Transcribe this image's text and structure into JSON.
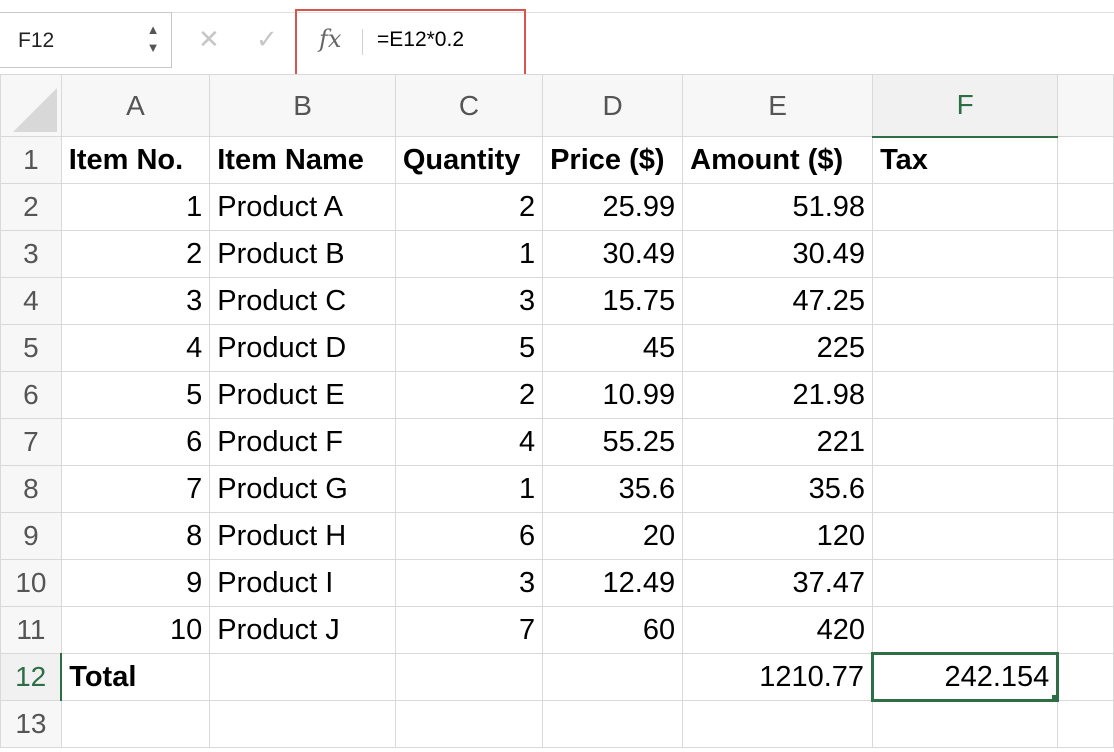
{
  "formula_bar": {
    "name_box": "F12",
    "stepper_up": "▲",
    "stepper_down": "▼",
    "cancel_glyph": "✕",
    "confirm_glyph": "✓",
    "fx_label": "fx",
    "formula": "=E12*0.2"
  },
  "columns": [
    "A",
    "B",
    "C",
    "D",
    "E",
    "F"
  ],
  "selected_cell": "F12",
  "accent_color": "#2e6e45",
  "highlight_color": "#d9534f",
  "rows": [
    {
      "num": "1",
      "cells": [
        "Item No.",
        "Item Name",
        "Quantity",
        "Price ($)",
        "Amount ($)",
        "Tax"
      ]
    },
    {
      "num": "2",
      "cells": [
        "1",
        "Product A",
        "2",
        "25.99",
        "51.98",
        ""
      ]
    },
    {
      "num": "3",
      "cells": [
        "2",
        "Product B",
        "1",
        "30.49",
        "30.49",
        ""
      ]
    },
    {
      "num": "4",
      "cells": [
        "3",
        "Product C",
        "3",
        "15.75",
        "47.25",
        ""
      ]
    },
    {
      "num": "5",
      "cells": [
        "4",
        "Product D",
        "5",
        "45",
        "225",
        ""
      ]
    },
    {
      "num": "6",
      "cells": [
        "5",
        "Product E",
        "2",
        "10.99",
        "21.98",
        ""
      ]
    },
    {
      "num": "7",
      "cells": [
        "6",
        "Product F",
        "4",
        "55.25",
        "221",
        ""
      ]
    },
    {
      "num": "8",
      "cells": [
        "7",
        "Product G",
        "1",
        "35.6",
        "35.6",
        ""
      ]
    },
    {
      "num": "9",
      "cells": [
        "8",
        "Product H",
        "6",
        "20",
        "120",
        ""
      ]
    },
    {
      "num": "10",
      "cells": [
        "9",
        "Product I",
        "3",
        "12.49",
        "37.47",
        ""
      ]
    },
    {
      "num": "11",
      "cells": [
        "10",
        "Product J",
        "7",
        "60",
        "420",
        ""
      ]
    },
    {
      "num": "12",
      "cells": [
        "Total",
        "",
        "",
        "",
        "1210.77",
        "242.154"
      ]
    },
    {
      "num": "13",
      "cells": [
        "",
        "",
        "",
        "",
        "",
        ""
      ]
    }
  ]
}
